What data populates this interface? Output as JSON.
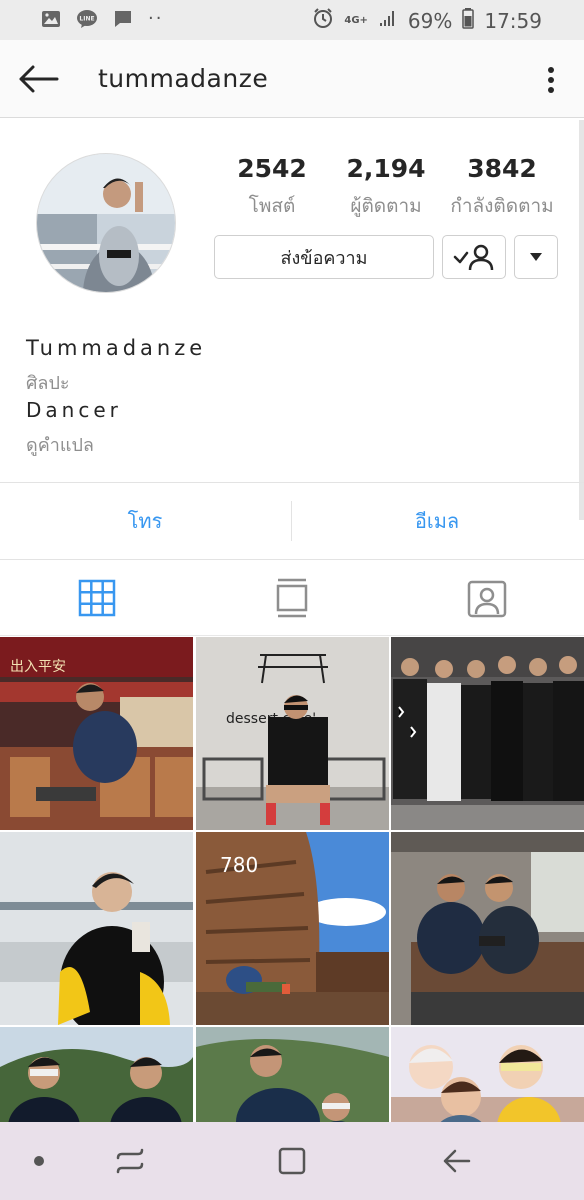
{
  "status_bar": {
    "network": "4G+",
    "battery": "69%",
    "time": "17:59",
    "icons": [
      "image-icon",
      "line-icon",
      "message-icon",
      "more-dots-icon",
      "alarm-icon",
      "signal-icon",
      "battery-icon"
    ]
  },
  "top_bar": {
    "username": "tummadanze",
    "back_icon": "arrow-left-icon",
    "more_icon": "vertical-dots-icon"
  },
  "profile": {
    "stats": [
      {
        "value": "2542",
        "label": "โพสต์"
      },
      {
        "value": "2,194",
        "label": "ผู้ติดตาม"
      },
      {
        "value": "3842",
        "label": "กำลังติดตาม"
      }
    ],
    "message_button": "ส่งข้อความ",
    "follow_icon": "following-check-icon",
    "dropdown_icon": "caret-down-icon"
  },
  "bio": {
    "name": "Tummadanze",
    "category": "ศิลปะ",
    "text": "Dancer",
    "translate": "ดูคำแปล"
  },
  "contact": {
    "call": "โทร",
    "email": "อีเมล"
  },
  "tabs": [
    {
      "icon": "grid-icon",
      "active": true
    },
    {
      "icon": "feed-icon",
      "active": false
    },
    {
      "icon": "tagged-icon",
      "active": false
    }
  ],
  "grid": {
    "photos": [
      {
        "text": "出入平安"
      },
      {
        "text": "dessert cafe'"
      },
      {
        "text": ""
      },
      {
        "text": ""
      },
      {
        "text": "780"
      },
      {
        "text": ""
      },
      {
        "text": ""
      },
      {
        "text": ""
      },
      {
        "text": ""
      }
    ]
  },
  "nav_bar": {
    "icons": [
      "dot-icon",
      "recents-icon",
      "home-icon",
      "back-icon"
    ]
  },
  "colors": {
    "accent": "#3897f0",
    "status_bar_bg": "#ececec",
    "nav_bar_bg": "#e9e0ea",
    "text": "#262626",
    "muted": "#8e8e8e"
  }
}
